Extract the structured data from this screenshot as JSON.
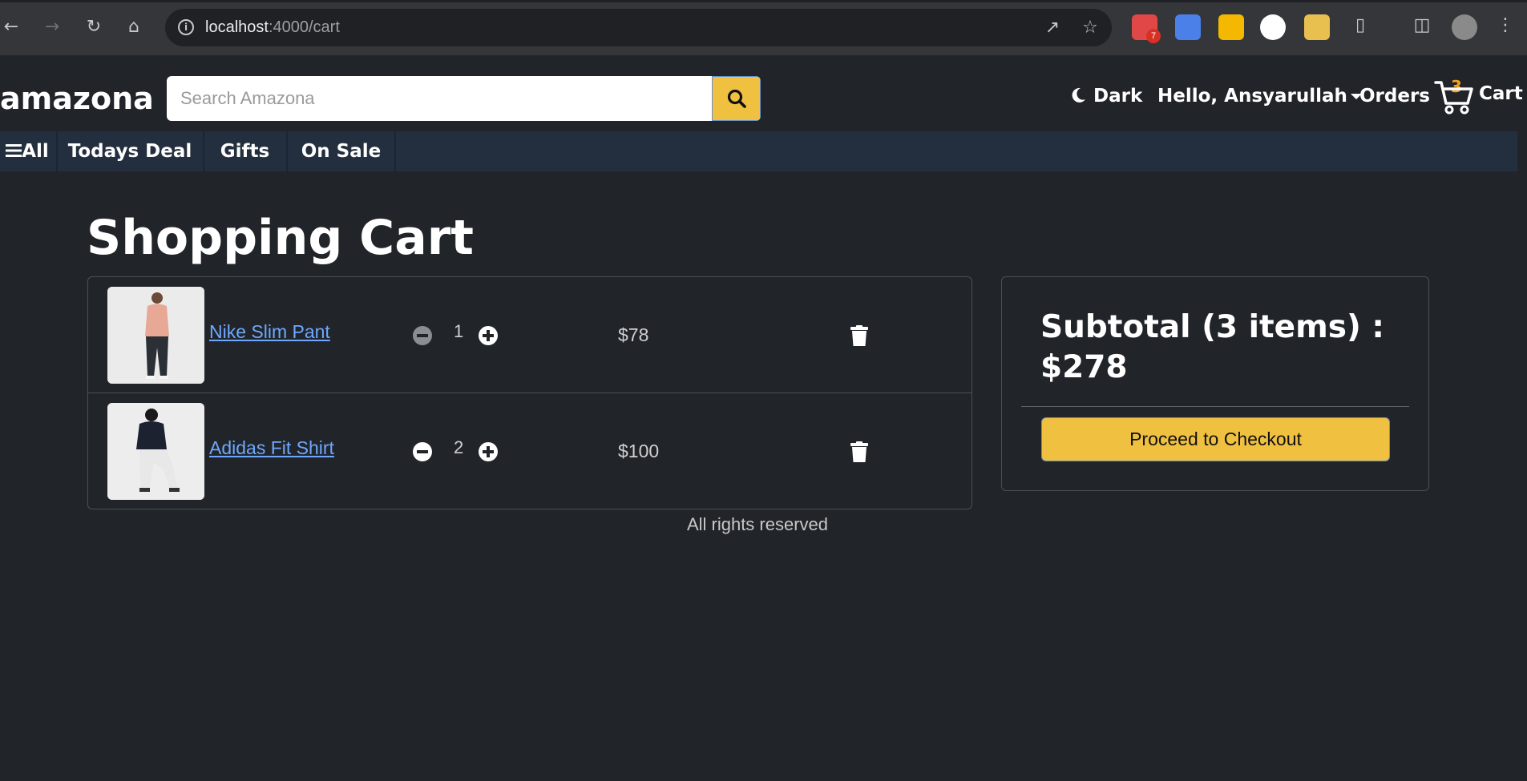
{
  "browser": {
    "url_host": "localhost",
    "url_path": ":4000/cart",
    "extension_badge": "7"
  },
  "navbar": {
    "brand": "amazona",
    "search_placeholder": "Search Amazona",
    "theme_label": "Dark",
    "user_label": "Hello, Ansyarullah",
    "orders_label": "Orders",
    "cart_label": "Cart",
    "cart_count": "3"
  },
  "subnav": {
    "all_label": "All",
    "items": [
      "Todays Deal",
      "Gifts",
      "On Sale"
    ]
  },
  "page": {
    "title": "Shopping Cart"
  },
  "cart": {
    "items": [
      {
        "name": "Nike Slim Pant",
        "quantity": "1",
        "price": "$78"
      },
      {
        "name": "Adidas Fit Shirt",
        "quantity": "2",
        "price": "$100"
      }
    ]
  },
  "summary": {
    "subtotal": "Subtotal (3 items) : $278",
    "checkout_label": "Proceed to Checkout"
  },
  "footer": {
    "text": "All rights reserved"
  },
  "colors": {
    "background": "#212529",
    "accent": "#f0c040",
    "subnav": "#232f3e",
    "link": "#6ea8fe"
  }
}
